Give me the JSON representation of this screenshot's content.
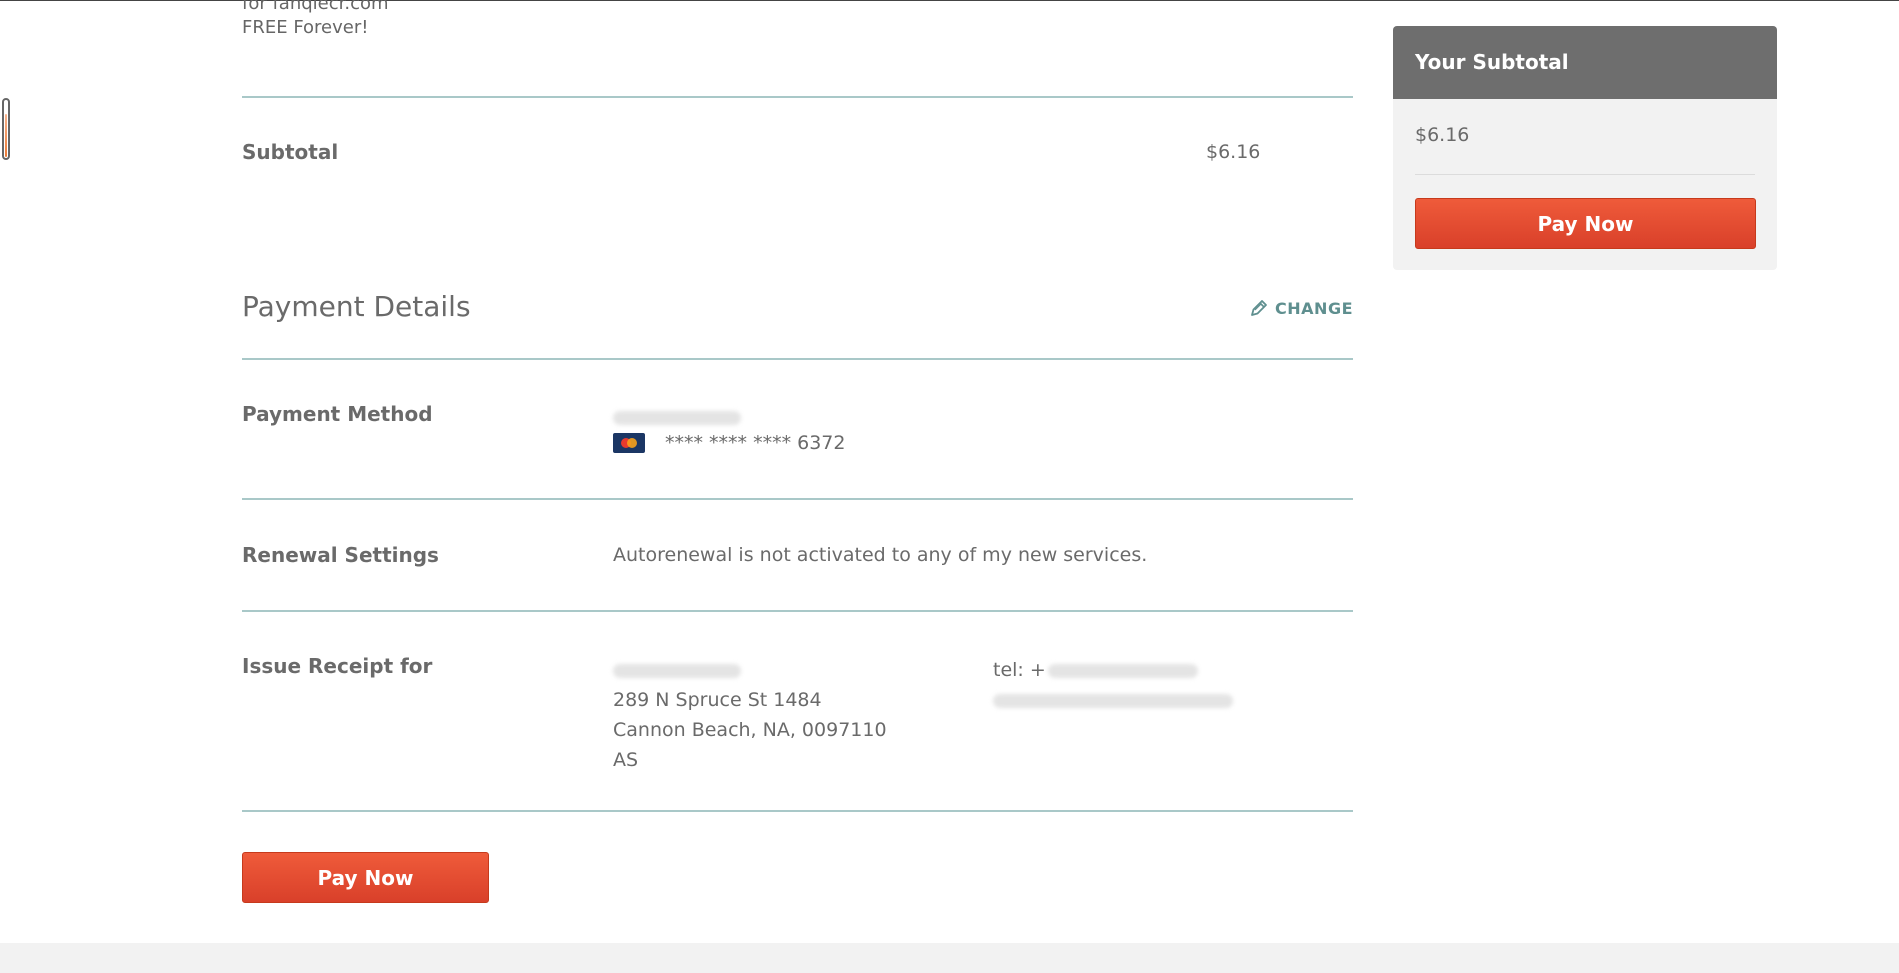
{
  "previous_item": {
    "line1": "for fanqiecr.com",
    "line2": "FREE Forever!"
  },
  "subtotal": {
    "label": "Subtotal",
    "value": "$6.16"
  },
  "payment_details": {
    "title": "Payment Details",
    "change_label": "CHANGE",
    "change_icon": "pencil-icon"
  },
  "payment_method": {
    "label": "Payment Method",
    "card_brand": "mastercard",
    "card_number": "**** **** **** 6372"
  },
  "renewal": {
    "label": "Renewal Settings",
    "text": "Autorenewal is not activated to any of my new services."
  },
  "receipt": {
    "label": "Issue Receipt for",
    "address_line1": "289 N Spruce St 1484",
    "address_line2": "Cannon Beach, NA,  0097110",
    "address_line3": "AS",
    "tel_prefix": "tel: +"
  },
  "actions": {
    "pay_now_label": "Pay Now"
  },
  "sidebar": {
    "title": "Your Subtotal",
    "amount": "$6.16",
    "pay_now_label": "Pay Now"
  },
  "colors": {
    "accent_button": "#e4492e",
    "divider": "#a9c8c8",
    "sidebar_header": "#6e6e6e",
    "link": "#5f8f8f"
  }
}
